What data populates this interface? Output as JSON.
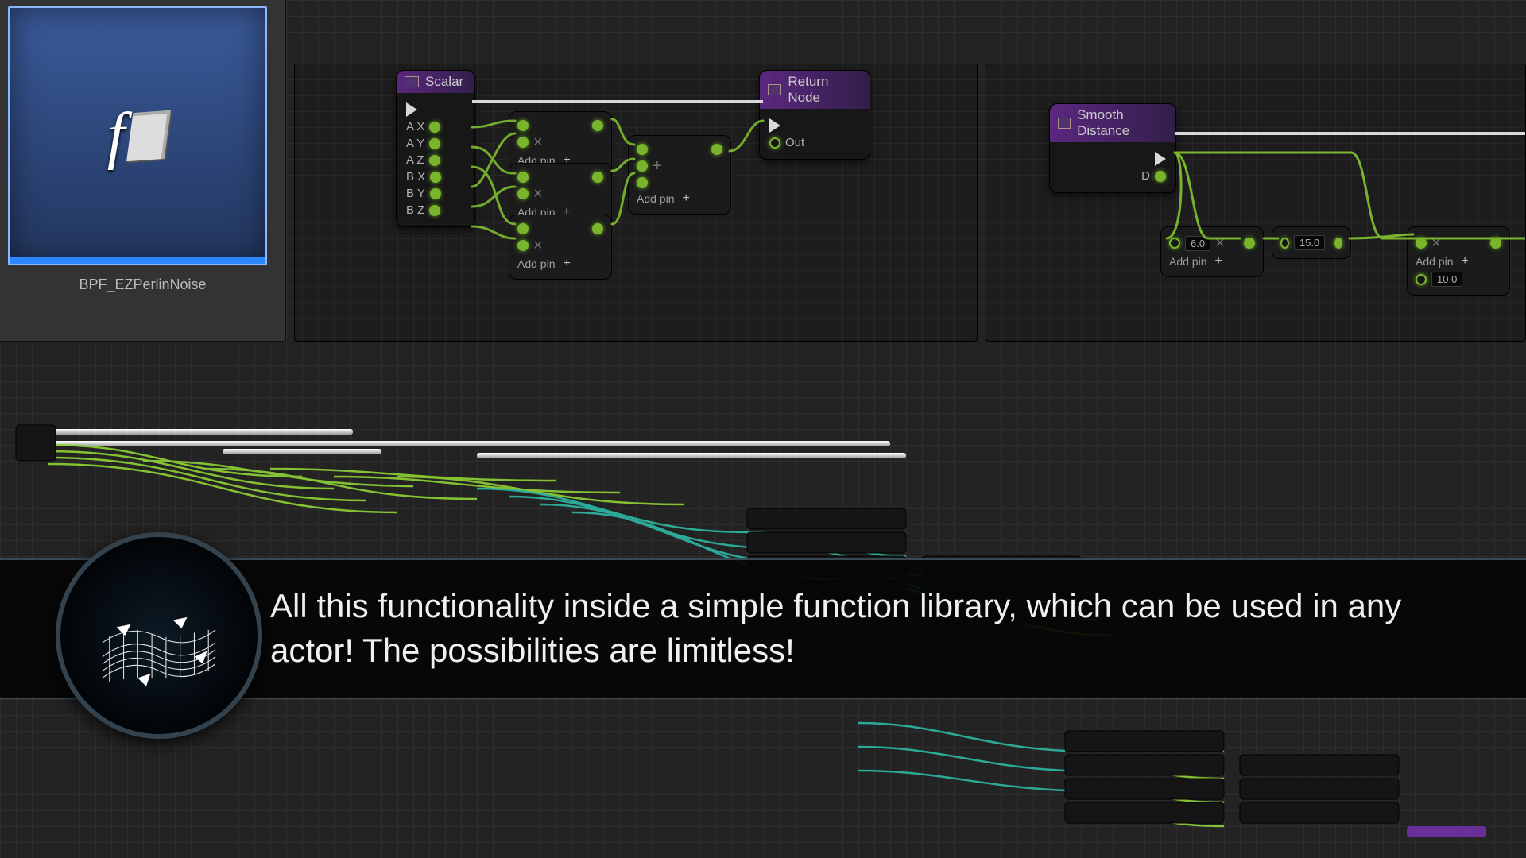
{
  "asset": {
    "name": "BPF_EZPerlinNoise",
    "icon_label": "f"
  },
  "nodes": {
    "scalar": {
      "title": "Scalar",
      "pins_in": [
        "A X",
        "A Y",
        "A Z",
        "B X",
        "B Y",
        "B Z"
      ]
    },
    "return": {
      "title": "Return Node",
      "out_label": "Out"
    },
    "smooth": {
      "title": "Smooth Distance",
      "d_label": "D"
    },
    "addpin_label": "Add pin",
    "val1": "6.0",
    "val2": "15.0",
    "val3": "10.0"
  },
  "banner": {
    "text": "All this functionality inside a simple function library, which can be used in any actor! The possibilities are limitless!"
  },
  "colors": {
    "wire_green": "#8fd435",
    "wire_teal": "#2fb8a5",
    "wire_orange": "#d8932c",
    "exec_white": "#ffffff",
    "header_purple": "#6a2f96"
  }
}
